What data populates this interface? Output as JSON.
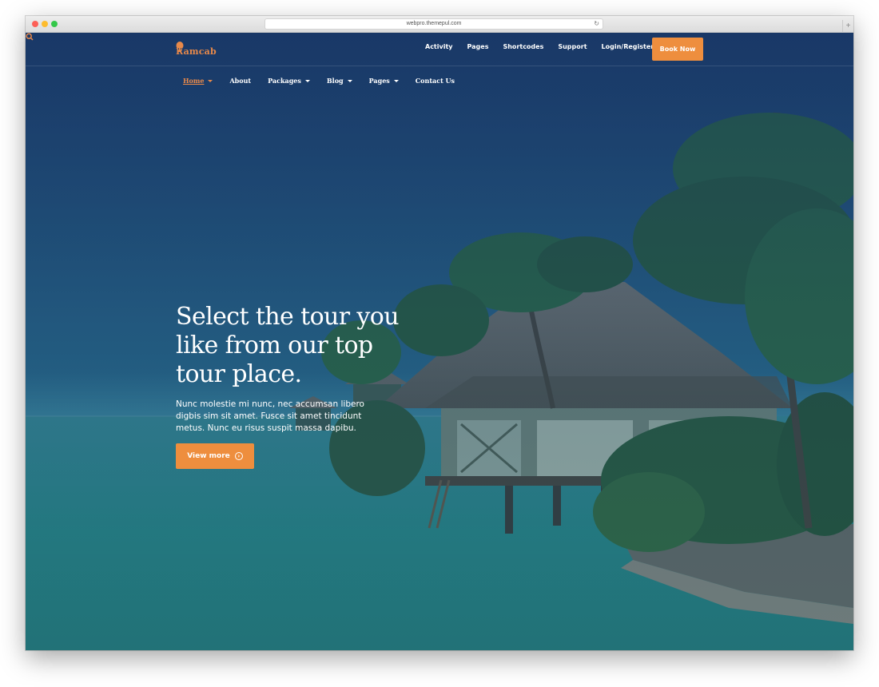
{
  "browser": {
    "url": "webpro.themepul.com",
    "reload_glyph": "↻",
    "new_tab_glyph": "+"
  },
  "brand": {
    "name": "Ramcab",
    "accent_color": "#ee8e3e",
    "logo_icon": "hot-air-balloon-icon"
  },
  "top_links": [
    "Activity",
    "Pages",
    "Shortcodes",
    "Support",
    "Login/Register"
  ],
  "book_button": "Book Now",
  "nav": {
    "items": [
      {
        "label": "Home",
        "dropdown": true,
        "active": true
      },
      {
        "label": "About",
        "dropdown": false,
        "active": false
      },
      {
        "label": "Packages",
        "dropdown": true,
        "active": false
      },
      {
        "label": "Blog",
        "dropdown": true,
        "active": false
      },
      {
        "label": "Pages",
        "dropdown": true,
        "active": false
      },
      {
        "label": "Contact Us",
        "dropdown": false,
        "active": false
      }
    ],
    "search_icon": "search-icon"
  },
  "hero": {
    "title": "Select the tour you like from our top tour place.",
    "description": "Nunc molestie mi nunc, nec accumsan libero digbis sim sit amet. Fusce sit amet tincidunt metus. Nunc eu risus suspit massa dapibu.",
    "cta_label": "View more",
    "cta_icon": "arrow-circle-right-icon"
  }
}
